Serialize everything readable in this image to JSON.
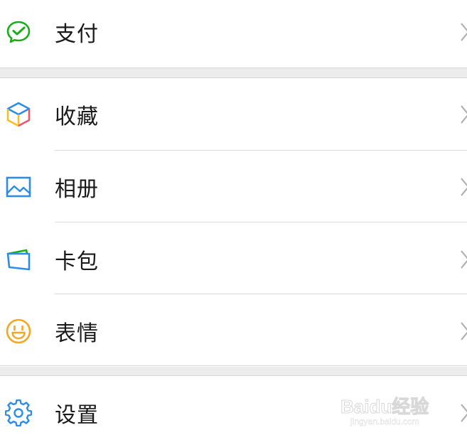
{
  "menu": {
    "items": [
      {
        "label": "支付",
        "icon": "wechat-pay-icon"
      },
      {
        "label": "收藏",
        "icon": "favorites-cube-icon"
      },
      {
        "label": "相册",
        "icon": "album-picture-icon"
      },
      {
        "label": "卡包",
        "icon": "card-wallet-icon"
      },
      {
        "label": "表情",
        "icon": "smiley-face-icon"
      },
      {
        "label": "设置",
        "icon": "gear-icon"
      }
    ]
  },
  "watermark": {
    "brand": "Baidu经验",
    "url": "jingyan.baidu.com"
  },
  "colors": {
    "pay_green": "#1aad19",
    "blue": "#2b8de8",
    "orange": "#f5a623",
    "background": "#ececec",
    "row": "#ffffff",
    "chevron": "#b2b2b2"
  }
}
